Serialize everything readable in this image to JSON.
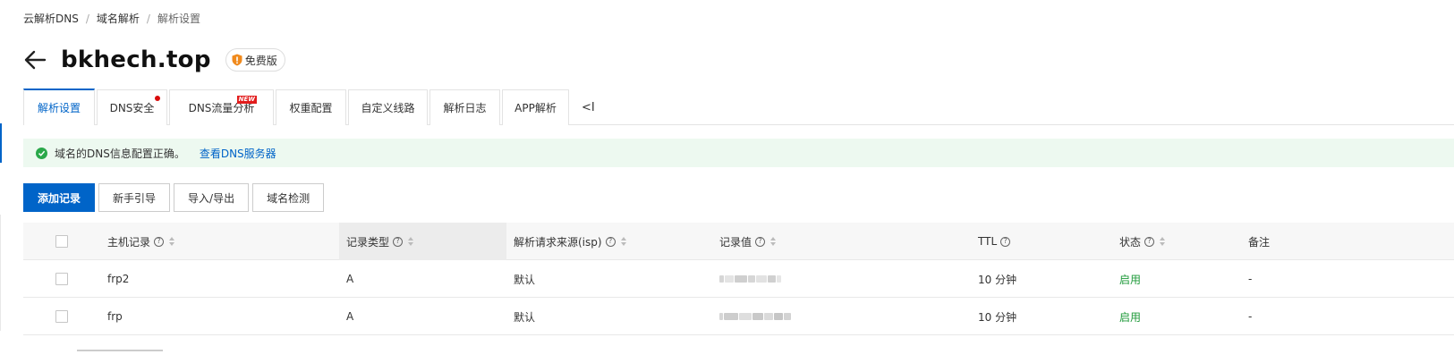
{
  "breadcrumb": [
    "云解析DNS",
    "域名解析",
    "解析设置"
  ],
  "domain": "bkhech.top",
  "edition": "免费版",
  "tabs": [
    {
      "label": "解析设置",
      "active": true
    },
    {
      "label": "DNS安全",
      "dot": true
    },
    {
      "label": "DNS流量分析",
      "badge": "NEW"
    },
    {
      "label": "权重配置"
    },
    {
      "label": "自定义线路"
    },
    {
      "label": "解析日志"
    },
    {
      "label": "APP解析"
    }
  ],
  "tab_collapse": "<I",
  "notice": {
    "text": "域名的DNS信息配置正确。",
    "link": "查看DNS服务器",
    "icon": "check-circle-icon"
  },
  "toolbar": {
    "add": "添加记录",
    "guide": "新手引导",
    "import_export": "导入/导出",
    "check": "域名检测"
  },
  "table": {
    "headers": {
      "host": "主机记录",
      "type": "记录类型",
      "isp": "解析请求来源(isp)",
      "value": "记录值",
      "ttl": "TTL",
      "status": "状态",
      "remark": "备注"
    },
    "rows": [
      {
        "host": "frp2",
        "type": "A",
        "isp": "默认",
        "value": "[redacted]",
        "ttl": "10 分钟",
        "status": "启用",
        "remark": "-"
      },
      {
        "host": "frp",
        "type": "A",
        "isp": "默认",
        "value": "[redacted]",
        "ttl": "10 分钟",
        "status": "启用",
        "remark": "-"
      }
    ]
  },
  "colors": {
    "primary": "#0064c8",
    "success": "#1f9a3a",
    "notice_bg": "#edf9f0",
    "alert_dot": "#d90b0b"
  }
}
